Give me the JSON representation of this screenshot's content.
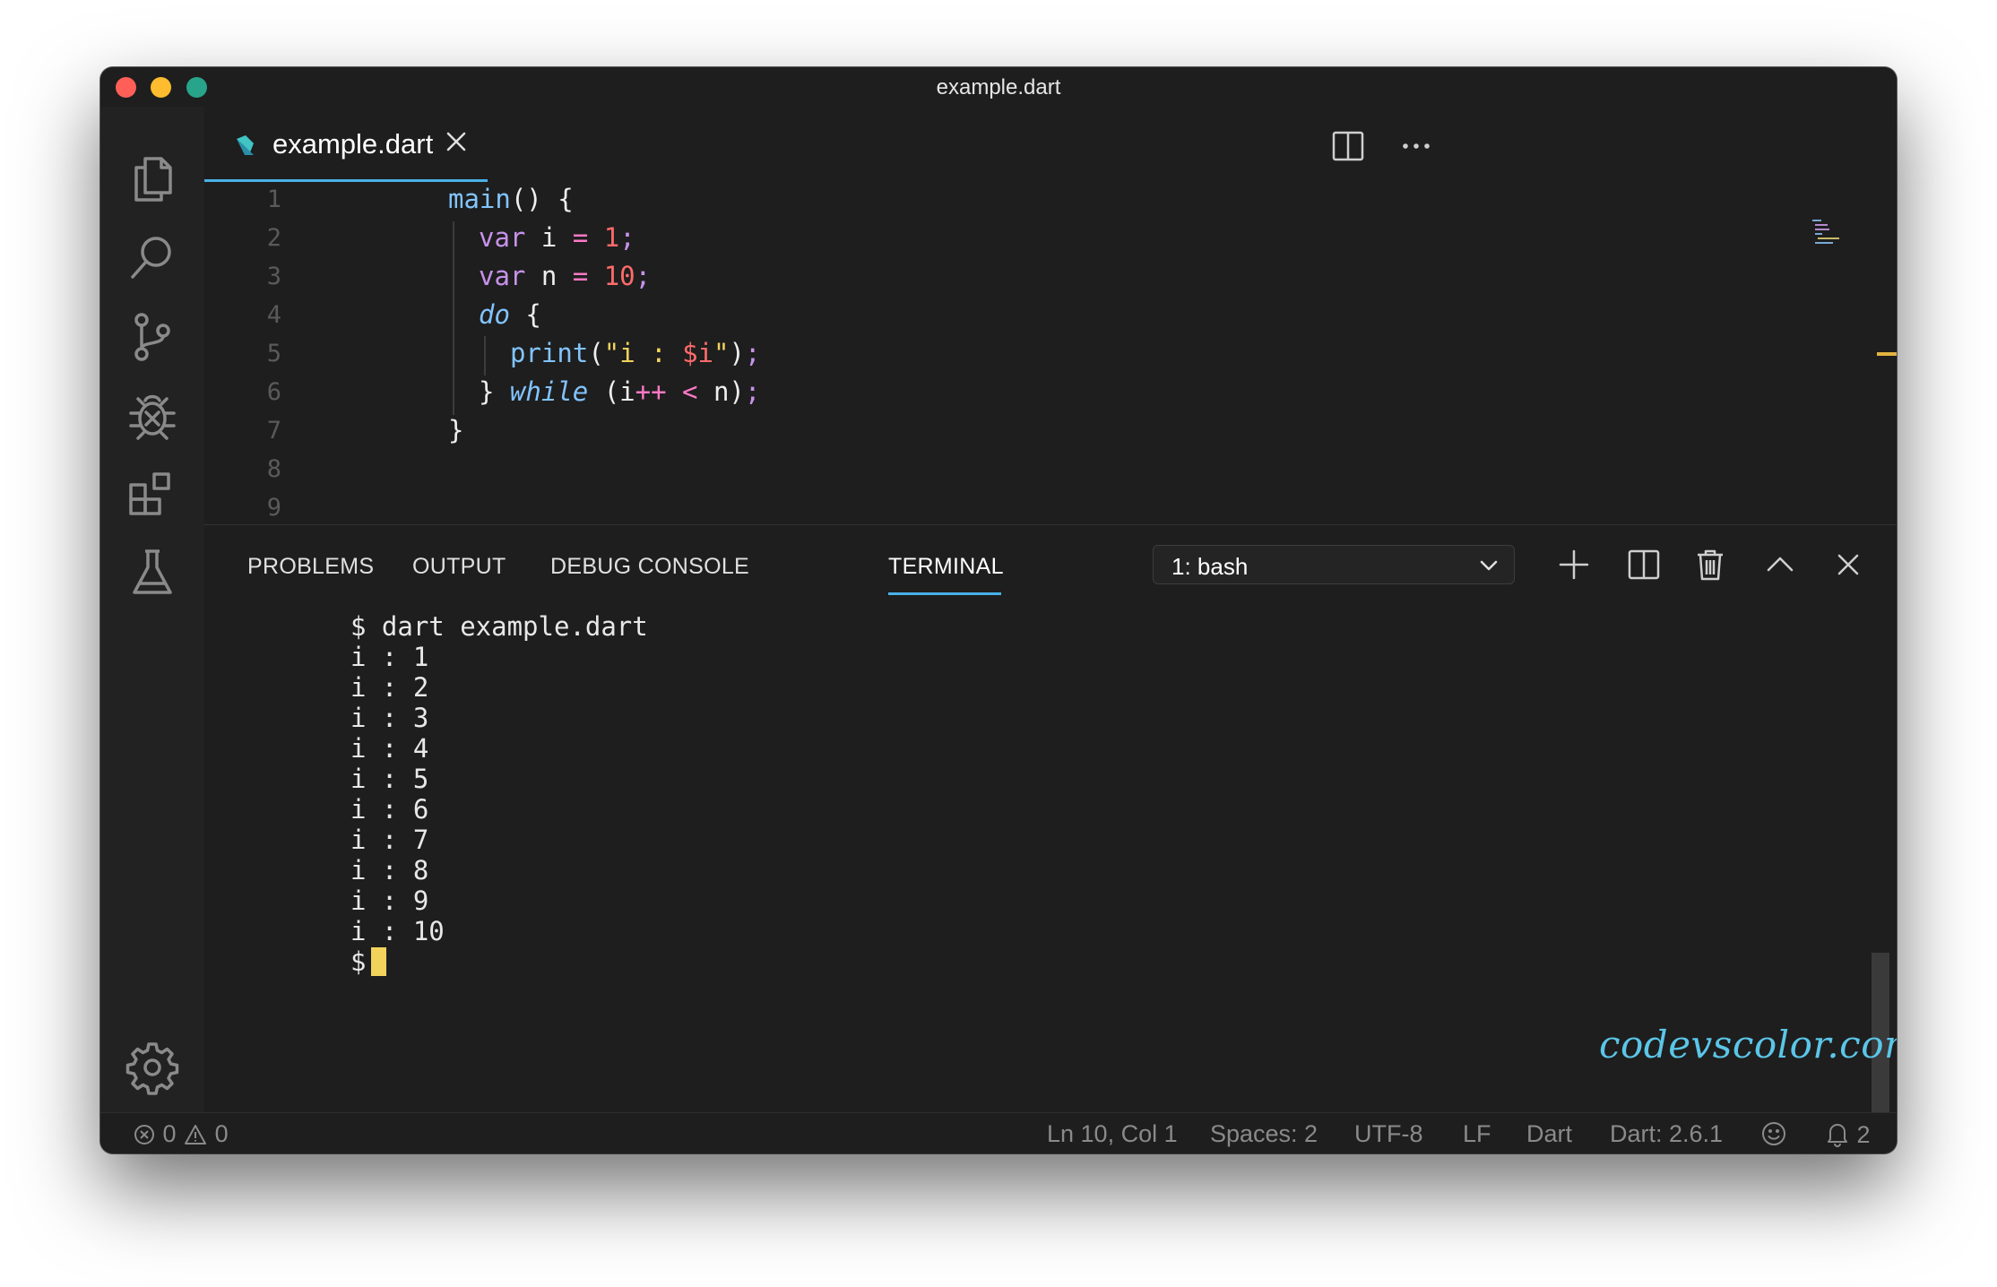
{
  "window": {
    "title": "example.dart"
  },
  "activity_bar": {
    "icons": [
      "files-icon",
      "search-icon",
      "source-control-icon",
      "debug-icon",
      "extensions-icon",
      "testing-flask-icon",
      "settings-gear-icon"
    ]
  },
  "editor": {
    "tab": {
      "label": "example.dart",
      "icon": "dart-file-icon"
    },
    "line_numbers": [
      "1",
      "2",
      "3",
      "4",
      "5",
      "6",
      "7",
      "8",
      "9"
    ]
  },
  "panel": {
    "tabs": [
      "PROBLEMS",
      "OUTPUT",
      "DEBUG CONSOLE",
      "TERMINAL"
    ],
    "active_tab": "TERMINAL",
    "terminal_select": "1: bash",
    "terminal_lines": [
      "$ dart example.dart",
      "i : 1",
      "i : 2",
      "i : 3",
      "i : 4",
      "i : 5",
      "i : 6",
      "i : 7",
      "i : 8",
      "i : 9",
      "i : 10"
    ],
    "prompt": "$"
  },
  "watermark": "codevscolor.com",
  "status_bar": {
    "errors": "0",
    "warnings": "0",
    "position": "Ln 10, Col 1",
    "spaces": "Spaces: 2",
    "encoding": "UTF-8",
    "eol": "LF",
    "language": "Dart",
    "sdk": "Dart: 2.6.1",
    "notifications": "2"
  },
  "colors": {
    "accent": "#4ab0e8",
    "keyword": "#c792ea",
    "function": "#82c4ff",
    "number": "#ff6b6b",
    "string": "#f1d35c",
    "cursor": "#f1d35c"
  }
}
